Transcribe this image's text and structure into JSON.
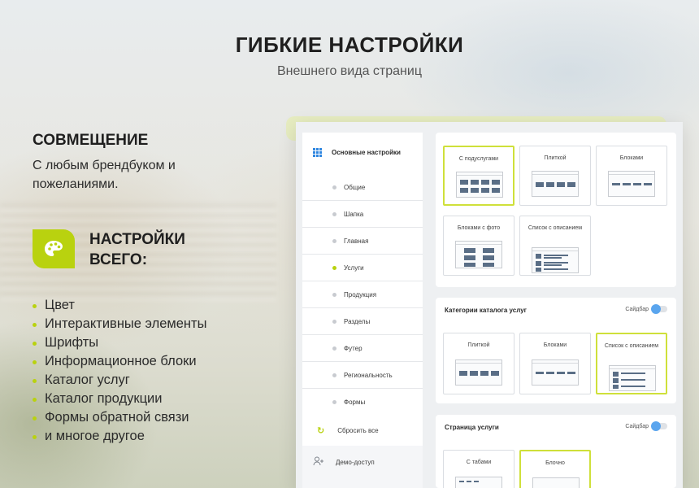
{
  "hero": {
    "title": "ГИБКИЕ НАСТРОЙКИ",
    "subtitle": "Внешнего вида страниц"
  },
  "compat": {
    "heading": "СОВМЕЩЕНИЕ",
    "text": "С любым брендбуком и пожеланиями."
  },
  "settings": {
    "heading": "НАСТРОЙКИ ВСЕГО:",
    "icon": "palette-icon",
    "items": [
      "Цвет",
      "Интерактивные элементы",
      "Шрифты",
      "Информационное блоки",
      "Каталог услуг",
      "Каталог продукции",
      "Формы обратной связи",
      "и многое другое"
    ]
  },
  "colors": {
    "accent": "#b9d20f",
    "toggle": "#5aa5ee",
    "grid_icon": "#2f86e0"
  },
  "panel": {
    "sidebar": {
      "header": "Основные настройки",
      "items": [
        {
          "label": "Общие",
          "active": false
        },
        {
          "label": "Шапка",
          "active": false
        },
        {
          "label": "Главная",
          "active": false
        },
        {
          "label": "Услуги",
          "active": true
        },
        {
          "label": "Продукция",
          "active": false
        },
        {
          "label": "Разделы",
          "active": false
        },
        {
          "label": "Футер",
          "active": false
        },
        {
          "label": "Региональность",
          "active": false
        },
        {
          "label": "Формы",
          "active": false
        }
      ],
      "reset": "Сбросить все",
      "demo": "Демо-доступ"
    },
    "top_options": [
      "С подуслугами",
      "Плиткой",
      "Блоками",
      "Блоками с фото",
      "Список с описанием"
    ],
    "catalog": {
      "title": "Категории каталога услуг",
      "toggle_label": "Сайдбар",
      "options": [
        "Плиткой",
        "Блоками",
        "Список с описанием"
      ]
    },
    "service_page": {
      "title": "Страница услуги",
      "toggle_label": "Сайдбар",
      "options": [
        "С табами",
        "Блочно"
      ]
    }
  }
}
